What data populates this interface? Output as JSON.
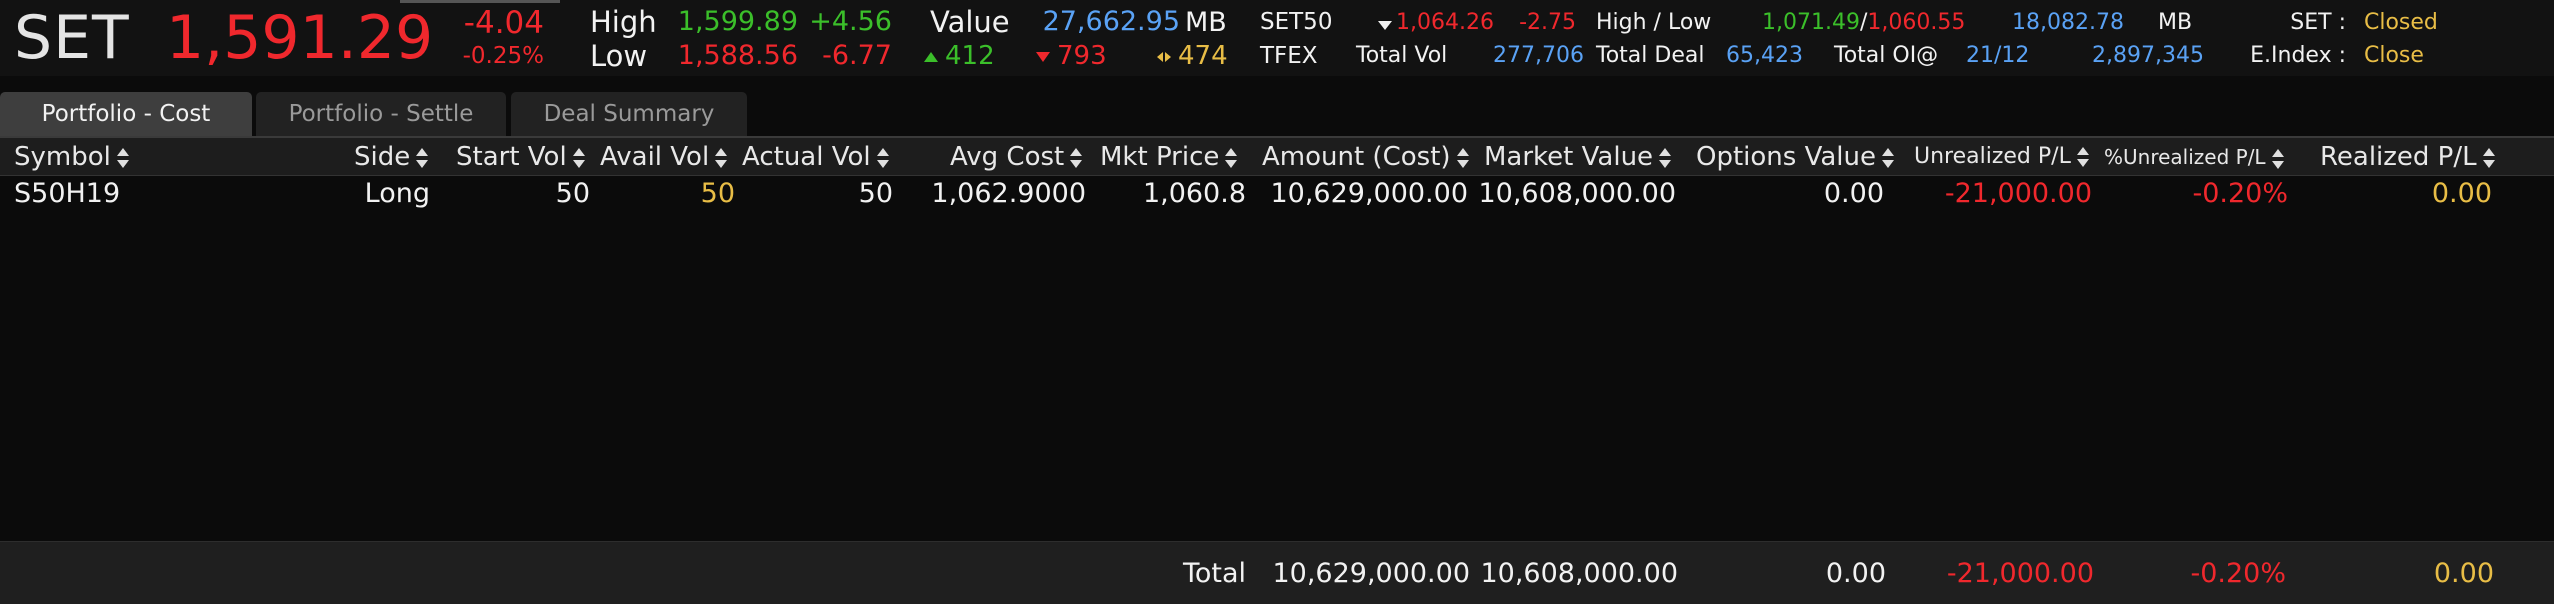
{
  "ticker": {
    "symbol": "SET",
    "last": "1,591.29",
    "change": "-4.04",
    "change_pct": "-0.25%",
    "high_label": "High",
    "high_value": "1,599.89",
    "high_change": "+4.56",
    "low_label": "Low",
    "low_value": "1,588.56",
    "low_change": "-6.77",
    "value_label": "Value",
    "value_amount": "27,662.95",
    "value_unit": "MB",
    "advances": "412",
    "declines": "793",
    "unchanged": "474",
    "set50_label": "SET50",
    "set50_value": "1,064.26",
    "set50_change": "-2.75",
    "high_low_label": "High / Low",
    "set50_high": "1,071.49",
    "set50_low": "1,060.55",
    "set50_sep": "/",
    "set50_value_mb": "18,082.78",
    "set50_unit": "MB",
    "tfex_label": "TFEX",
    "total_vol_label": "Total Vol",
    "total_vol": "277,706",
    "total_deal_label": "Total Deal",
    "total_deal": "65,423",
    "total_oi_label": "Total OI@",
    "total_oi_date": "21/12",
    "total_oi": "2,897,345",
    "set_status_label": "SET :",
    "set_status": "Closed",
    "eindex_label": "E.Index :",
    "eindex_status": "Close"
  },
  "colors": {
    "negative": "#f0282d",
    "positive": "#3bbf2a",
    "info": "#5aa2f5",
    "accent": "#e8bd46"
  },
  "tabs": [
    {
      "label": "Portfolio - Cost",
      "active": true
    },
    {
      "label": "Portfolio - Settle",
      "active": false
    },
    {
      "label": "Deal Summary",
      "active": false
    }
  ],
  "table": {
    "columns": {
      "symbol": "Symbol",
      "side": "Side",
      "start_vol": "Start Vol",
      "avail_vol": "Avail Vol",
      "actual_vol": "Actual Vol",
      "avg_cost": "Avg Cost",
      "mkt_price": "Mkt Price",
      "amount_cost": "Amount (Cost)",
      "market_value": "Market Value",
      "options_value": "Options Value",
      "unrealized_pl": "Unrealized P/L",
      "unrealized_pct": "%Unrealized P/L",
      "realized_pl": "Realized P/L"
    },
    "rows": [
      {
        "symbol": "S50H19",
        "side": "Long",
        "start_vol": "50",
        "avail_vol": "50",
        "actual_vol": "50",
        "avg_cost": "1,062.9000",
        "mkt_price": "1,060.8",
        "amount_cost": "10,629,000.00",
        "market_value": "10,608,000.00",
        "options_value": "0.00",
        "unrealized_pl": "-21,000.00",
        "unrealized_pct": "-0.20%",
        "realized_pl": "0.00"
      }
    ],
    "total": {
      "label": "Total",
      "amount_cost": "10,629,000.00",
      "market_value": "10,608,000.00",
      "options_value": "0.00",
      "unrealized_pl": "-21,000.00",
      "unrealized_pct": "-0.20%",
      "realized_pl": "0.00"
    }
  }
}
